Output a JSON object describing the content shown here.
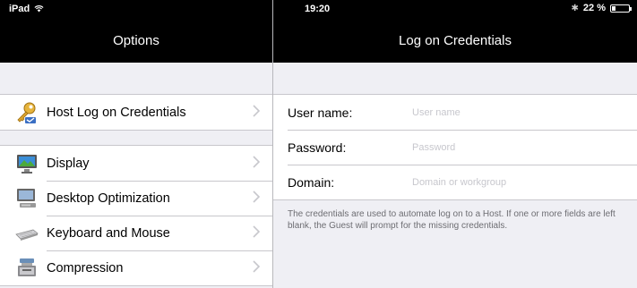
{
  "status": {
    "device": "iPad",
    "time": "19:20",
    "battery_text": "22 %",
    "battery_level": 0.22,
    "icons": [
      "wifi-icon",
      "bluetooth-icon",
      "battery-icon"
    ]
  },
  "left": {
    "title": "Options",
    "groups": [
      {
        "items": [
          {
            "label": "Host Log on Credentials",
            "icon": "key-icon"
          }
        ]
      },
      {
        "items": [
          {
            "label": "Display",
            "icon": "display-icon"
          },
          {
            "label": "Desktop Optimization",
            "icon": "desktop-icon"
          },
          {
            "label": "Keyboard and Mouse",
            "icon": "keyboard-icon"
          },
          {
            "label": "Compression",
            "icon": "compression-icon"
          }
        ]
      }
    ]
  },
  "right": {
    "title": "Log on Credentials",
    "fields": [
      {
        "label": "User name:",
        "placeholder": "User name",
        "value": ""
      },
      {
        "label": "Password:",
        "placeholder": "Password",
        "value": ""
      },
      {
        "label": "Domain:",
        "placeholder": "Domain or workgroup",
        "value": ""
      }
    ],
    "footnote": "The credentials are used to automate log on to a Host. If one or more fields are left blank, the Guest will prompt for the missing credentials."
  },
  "colors": {
    "bar_bg": "#000000",
    "page_bg": "#efeff4",
    "separator": "#c8c7cc",
    "chevron": "#c7c7cc",
    "placeholder": "#c7c7cd",
    "footnote": "#6d6d72"
  }
}
